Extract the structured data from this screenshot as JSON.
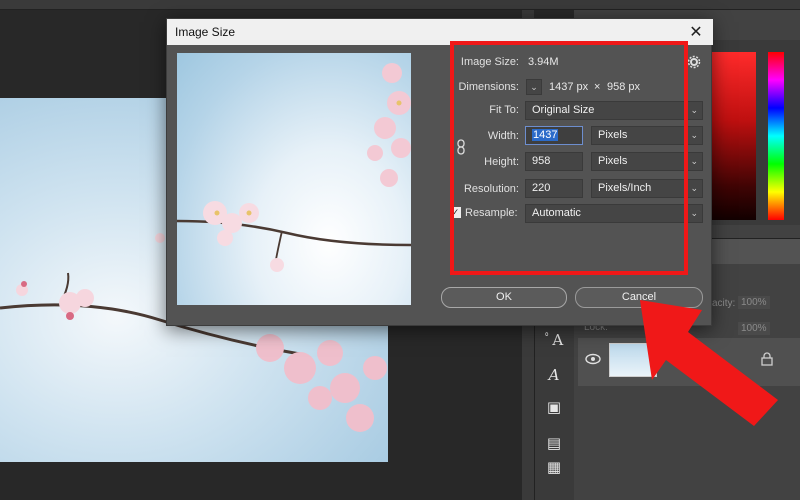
{
  "dialog": {
    "title": "Image Size",
    "close_glyph": "✕",
    "image_size_label": "Image Size:",
    "image_size_value": "3.94M",
    "dimensions_label": "Dimensions:",
    "dimensions_width": "1437 px",
    "dimensions_times": "×",
    "dimensions_height": "958 px",
    "fit_to_label": "Fit To:",
    "fit_to_value": "Original Size",
    "width_label": "Width:",
    "width_value": "1437",
    "width_unit": "Pixels",
    "height_label": "Height:",
    "height_value": "958",
    "height_unit": "Pixels",
    "resolution_label": "Resolution:",
    "resolution_value": "220",
    "resolution_unit": "Pixels/Inch",
    "resample_label": "Resample:",
    "resample_value": "Automatic",
    "resample_checked": true,
    "ok_label": "OK",
    "cancel_label": "Cancel"
  },
  "layers_panel": {
    "opacity_label": "acity:",
    "opacity_value": "100%",
    "lock_label": "Lock:",
    "fill_value": "100%"
  },
  "icons": {
    "eye": "eye-icon",
    "lock": "lock-icon",
    "chain": "chain-link-icon",
    "gear": "gear-icon"
  },
  "colors": {
    "highlight": "#f01818",
    "arrow": "#f01818",
    "selection": "#2b6bc9"
  }
}
